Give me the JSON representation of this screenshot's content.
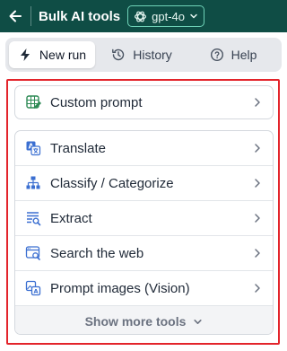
{
  "header": {
    "title": "Bulk AI tools",
    "model": "gpt-4o"
  },
  "tabs": [
    {
      "label": "New run",
      "icon": "bolt-icon",
      "active": true
    },
    {
      "label": "History",
      "icon": "history-icon",
      "active": false
    },
    {
      "label": "Help",
      "icon": "help-icon",
      "active": false
    }
  ],
  "tools_primary": [
    {
      "label": "Custom prompt",
      "icon": "custom-prompt-icon"
    }
  ],
  "tools": [
    {
      "label": "Translate",
      "icon": "translate-icon"
    },
    {
      "label": "Classify / Categorize",
      "icon": "classify-icon"
    },
    {
      "label": "Extract",
      "icon": "extract-icon"
    },
    {
      "label": "Search the web",
      "icon": "search-web-icon"
    },
    {
      "label": "Prompt images (Vision)",
      "icon": "vision-icon"
    }
  ],
  "show_more_label": "Show more tools",
  "colors": {
    "header_bg": "#0f4d45",
    "accent": "#3b6fd1",
    "highlight_border": "#e3242b"
  }
}
